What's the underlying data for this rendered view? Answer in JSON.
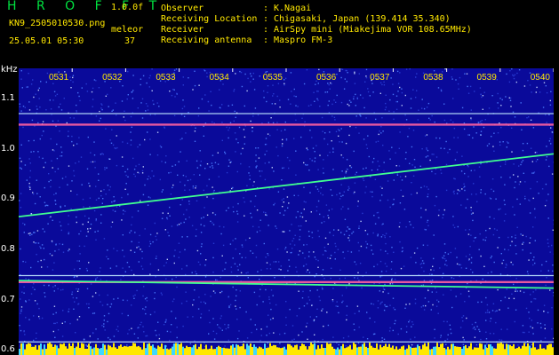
{
  "header": {
    "app_title": "H R O F F T",
    "version": "1.0.0f",
    "filename": "KN9_2505010530.png",
    "mode_label": "meleor",
    "datetime": "25.05.01 05:30",
    "count": "37",
    "info": [
      {
        "label": "Observer",
        "value": "K.Nagai"
      },
      {
        "label": "Receiving Location",
        "value": "Chigasaki, Japan (139.414 35.340)"
      },
      {
        "label": "Receiver",
        "value": "AirSpy mini (Miakejima VOR 108.65MHz)"
      },
      {
        "label": "Receiving antenna",
        "value": "Maspro FM-3"
      }
    ]
  },
  "colors": {
    "background": "#0a0a9a",
    "noise": "#4a7cff",
    "trace": "#40ff90",
    "carrier": "#ff60a0",
    "title": "#00e040",
    "label": "#ffe800"
  },
  "chart_data": {
    "type": "heatmap",
    "title": "",
    "ylabel": "kHz",
    "xlabel": "",
    "y_tick_labels": [
      "1.1",
      "1.0",
      "0.9",
      "0.8",
      "0.7",
      "0.6"
    ],
    "x_tick_labels": [
      "0531",
      "0532",
      "0533",
      "0534",
      "0535",
      "0536",
      "0537",
      "0538",
      "0539",
      "0540"
    ],
    "xlim": [
      "05:30",
      "05:40"
    ],
    "ylim": [
      0.59,
      1.16
    ],
    "horizontal_lines_khz": [
      1.07,
      1.048,
      0.748,
      0.735,
      0.616
    ],
    "drifting_trace": {
      "start": {
        "time": "05:30",
        "khz": 0.865
      },
      "end": {
        "time": "05:40",
        "khz": 0.99
      }
    },
    "lower_trace": {
      "start": {
        "time": "05:30",
        "khz": 0.738
      },
      "end": {
        "time": "05:40",
        "khz": 0.723
      }
    }
  }
}
